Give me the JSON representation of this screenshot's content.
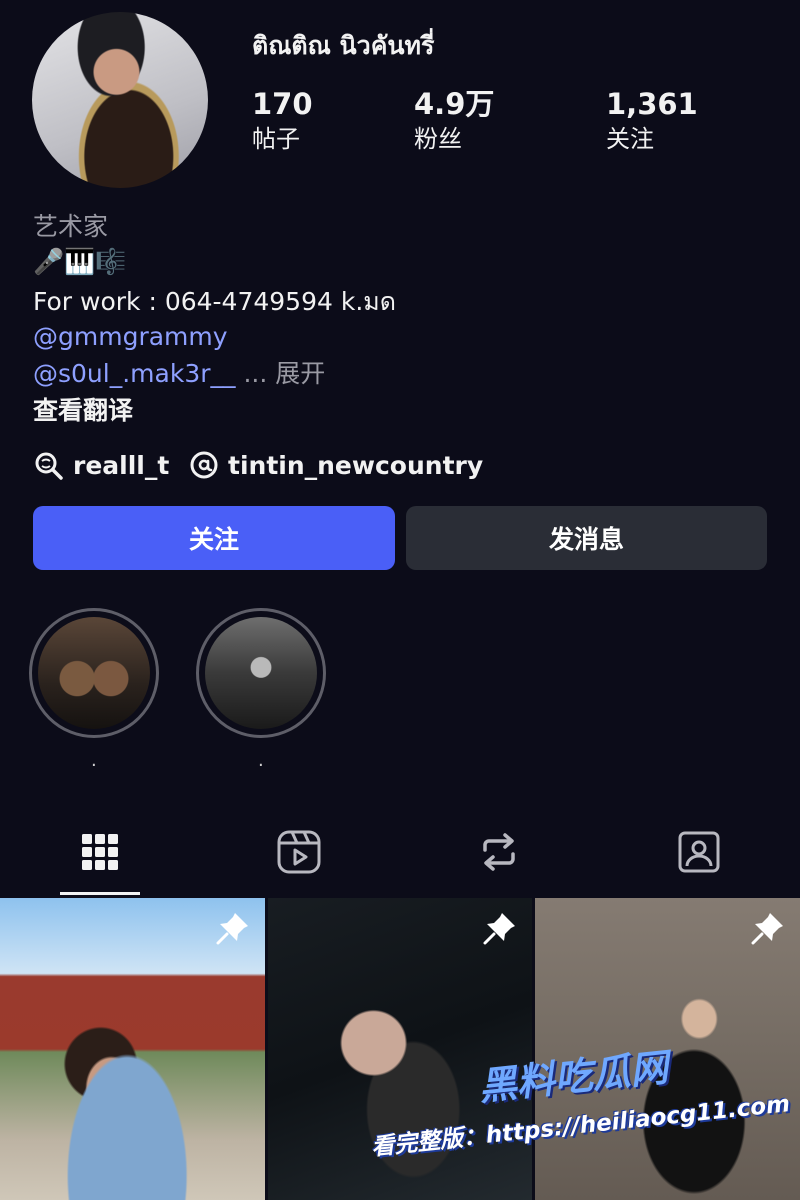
{
  "profile": {
    "username": "ติณติณ นิวคันทรี่",
    "stats": [
      {
        "value": "170",
        "label": "帖子"
      },
      {
        "value": "4.9万",
        "label": "粉丝"
      },
      {
        "value": "1,361",
        "label": "关注"
      }
    ]
  },
  "bio": {
    "category": "艺术家",
    "emojis": "🎤🎹🎼",
    "work": "For work : 064-4749594 k.มด",
    "mention1": "@gmmgrammy",
    "mention2": "@s0ul_.mak3r__",
    "ellipsis": "...",
    "expand": "展开",
    "translate": "查看翻译"
  },
  "links": {
    "threads_user": "realll_t",
    "threads2_user": "tintin_newcountry"
  },
  "buttons": {
    "follow": "关注",
    "message": "发消息"
  },
  "highlights": [
    {
      "label": "."
    },
    {
      "label": "."
    }
  ],
  "tabs": [
    "posts-grid",
    "reels",
    "reposts",
    "tagged"
  ],
  "colors": {
    "background": "#0c0c19",
    "accent": "#4a5ff7",
    "link": "#8ea0ff",
    "secondary_button": "#2a2d36"
  },
  "watermark": {
    "title": "黑料吃瓜网",
    "url": "看完整版：https://heiliaocg11.com"
  }
}
